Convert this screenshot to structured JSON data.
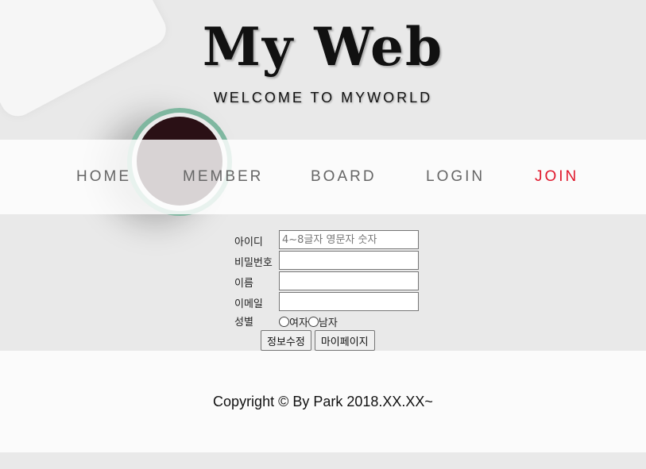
{
  "header": {
    "title": "My Web",
    "subtitle": "WELCOME TO MYWORLD"
  },
  "nav": {
    "items": [
      {
        "label": "HOME"
      },
      {
        "label": "MEMBER"
      },
      {
        "label": "BOARD"
      },
      {
        "label": "LOGIN"
      },
      {
        "label": "JOIN",
        "active": true
      }
    ]
  },
  "form": {
    "id_label": "아이디",
    "id_placeholder": "4~8글자 영문자 숫자",
    "password_label": "비밀번호",
    "name_label": "이름",
    "email_label": "이메일",
    "gender_label": "성별",
    "gender_options": [
      "여자",
      "남자"
    ],
    "update_button": "정보수정",
    "mypage_button": "마이페이지"
  },
  "footer": {
    "copyright": "Copyright © By Park 2018.XX.XX~"
  },
  "colors": {
    "active_nav": "#e0182c",
    "nav_text": "#666666",
    "background": "#e9e9e9"
  }
}
